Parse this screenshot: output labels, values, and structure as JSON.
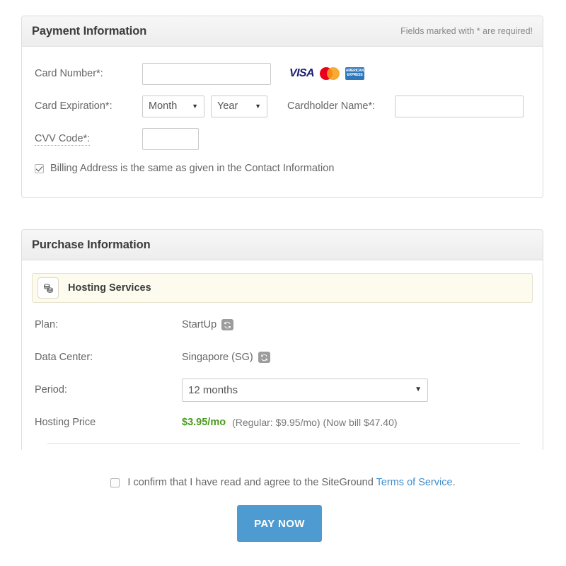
{
  "payment": {
    "title": "Payment Information",
    "required_note": "Fields marked with * are required!",
    "card_number": {
      "label": "Card Number*:",
      "value": "",
      "placeholder": ""
    },
    "accepted_cards": [
      {
        "name": "visa-icon",
        "label": "VISA"
      },
      {
        "name": "mastercard-icon",
        "label": "MasterCard"
      },
      {
        "name": "amex-icon",
        "label": "AMERICAN EXPRESS"
      }
    ],
    "expiration": {
      "label": "Card Expiration*:",
      "month_value": "Month",
      "year_value": "Year"
    },
    "cardholder": {
      "label": "Cardholder Name*:",
      "value": "",
      "placeholder": ""
    },
    "cvv": {
      "label": "CVV Code*:",
      "value": "",
      "placeholder": ""
    },
    "billing_same": {
      "label": "Billing Address is the same as given in the Contact Information",
      "checked": true
    }
  },
  "purchase": {
    "title": "Purchase Information",
    "service": {
      "icon": "coins-stack-icon",
      "title": "Hosting Services"
    },
    "rows": [
      {
        "label": "Plan:",
        "value": "StartUp",
        "action_icon": "refresh-icon"
      },
      {
        "label": "Data Center:",
        "value": "Singapore (SG)",
        "action_icon": "refresh-icon"
      }
    ],
    "period": {
      "label": "Period:",
      "value": "12 months"
    },
    "price": {
      "label": "Hosting Price",
      "amount": "$3.95/mo",
      "details": "(Regular: $9.95/mo) (Now bill $47.40)",
      "amount_color": "#4a9b1e"
    }
  },
  "footer": {
    "terms": {
      "checked": false,
      "text_before": "I confirm that I have read and agree to the SiteGround ",
      "link_text": "Terms of Service",
      "text_after": "."
    },
    "pay_button": "PAY NOW",
    "pay_button_color": "#4e9bd1"
  },
  "glyphs": {
    "caret_down": "▼",
    "refresh": "⟳",
    "visa": "VISA",
    "amex_line1": "AMERICAN",
    "amex_line2": "EXPRESS"
  }
}
